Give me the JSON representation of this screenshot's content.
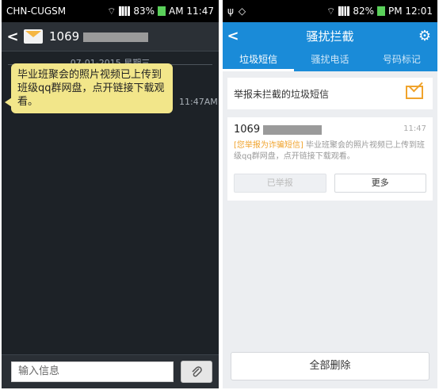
{
  "left": {
    "status_bar": {
      "carrier": "CHN-CUGSM",
      "battery": "83%",
      "time": "AM 11:47"
    },
    "header": {
      "number": "1069"
    },
    "date_divider": "07-01-2015 星期三",
    "message": {
      "text": "毕业班聚会的照片视频已上传到班级qq群网盘，点开链接下载观看。",
      "time": "11:47AM"
    },
    "input": {
      "placeholder": "输入信息"
    }
  },
  "right": {
    "status_bar": {
      "battery": "82%",
      "time": "PM 12:01"
    },
    "header": {
      "title": "骚扰拦截"
    },
    "tabs": [
      "垃圾短信",
      "骚扰电话",
      "号码标记"
    ],
    "report_row": {
      "label": "举报未拦截的垃圾短信"
    },
    "message_card": {
      "number": "1069",
      "time": "11:47",
      "tag": "[您举报为诈骗短信]",
      "body": "毕业班聚会的照片视频已上传到班级qq群网盘，点开链接下载观看。"
    },
    "buttons": {
      "reported": "已举报",
      "more": "更多"
    },
    "delete_all": "全部删除"
  },
  "colors": {
    "accent": "#1a8bd8",
    "bubble": "#f2e68a",
    "tag": "#f0a32c"
  }
}
